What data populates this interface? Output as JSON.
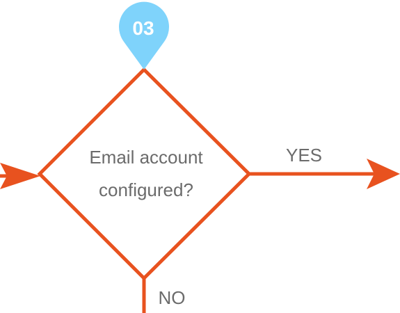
{
  "step_badge": {
    "number": "03",
    "color": "#7fd3fb"
  },
  "decision": {
    "line1": "Email account",
    "line2": "configured?",
    "stroke_color": "#e8521f",
    "text_color": "#6b6b6b"
  },
  "branches": {
    "yes_label": "YES",
    "no_label": "NO"
  }
}
